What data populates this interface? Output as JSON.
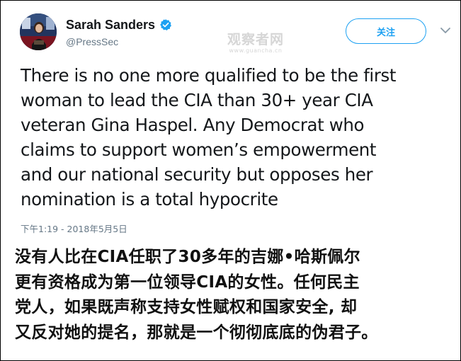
{
  "tweet": {
    "display_name": "Sarah Sanders",
    "handle": "@PressSec",
    "follow_label": "关注",
    "text": "There is no one more qualified to be the first\nwoman to lead the CIA than 30+ year CIA\nveteran Gina Haspel. Any Democrat who\nclaims to support women’s empowerment\nand our national security but opposes her\nnomination is a total hypocrite",
    "timestamp": "下午1:19 - 2018年5月5日"
  },
  "watermark": {
    "main": "观察者网",
    "sub": "www.guancha.cn"
  },
  "translation": {
    "text": "没有人比在CIA任职了30多年的吉娜•哈斯佩尔\n更有资格成为第一位领导CIA的女性。任何民主\n党人，如果既声称支持女性赋权和国家安全, 却\n又反对她的提名，那就是一个彻彻底底的伪君子。"
  },
  "colors": {
    "accent": "#1da1f2",
    "text": "#14171a",
    "muted": "#657786"
  },
  "icons": {
    "verified": "verified-badge-icon",
    "caret": "chevron-down-icon"
  }
}
